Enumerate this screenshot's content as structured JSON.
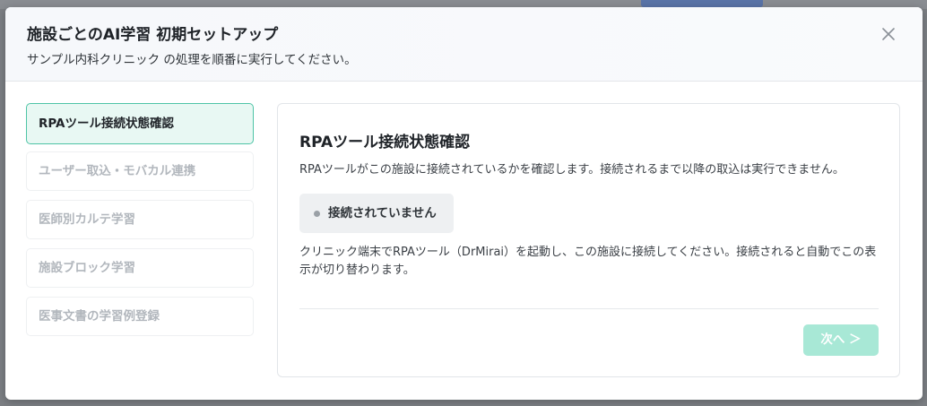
{
  "modal": {
    "title": "施設ごとのAI学習 初期セットアップ",
    "subtitle": "サンプル内科クリニック の処理を順番に実行してください。",
    "close_icon": "close-icon"
  },
  "steps": [
    {
      "label": "RPAツール接続状態確認",
      "active": true
    },
    {
      "label": "ユーザー取込・モバカル連携",
      "active": false
    },
    {
      "label": "医師別カルテ学習",
      "active": false
    },
    {
      "label": "施設ブロック学習",
      "active": false
    },
    {
      "label": "医事文書の学習例登録",
      "active": false
    }
  ],
  "content": {
    "title": "RPAツール接続状態確認",
    "description": "RPAツールがこの施設に接続されているかを確認します。接続されるまで以降の取込は実行できません。",
    "status": "接続されていません",
    "note": "クリニック端末でRPAツール（DrMirai）を起動し、この施設に接続してください。接続されると自動でこの表示が切り替わります。",
    "next_label": "次へ ＞"
  },
  "colors": {
    "accent": "#4ec4a6",
    "accent_light": "#e8f8f3",
    "button_disabled": "#a8e8d6",
    "status_dot": "#9aa0a6"
  }
}
